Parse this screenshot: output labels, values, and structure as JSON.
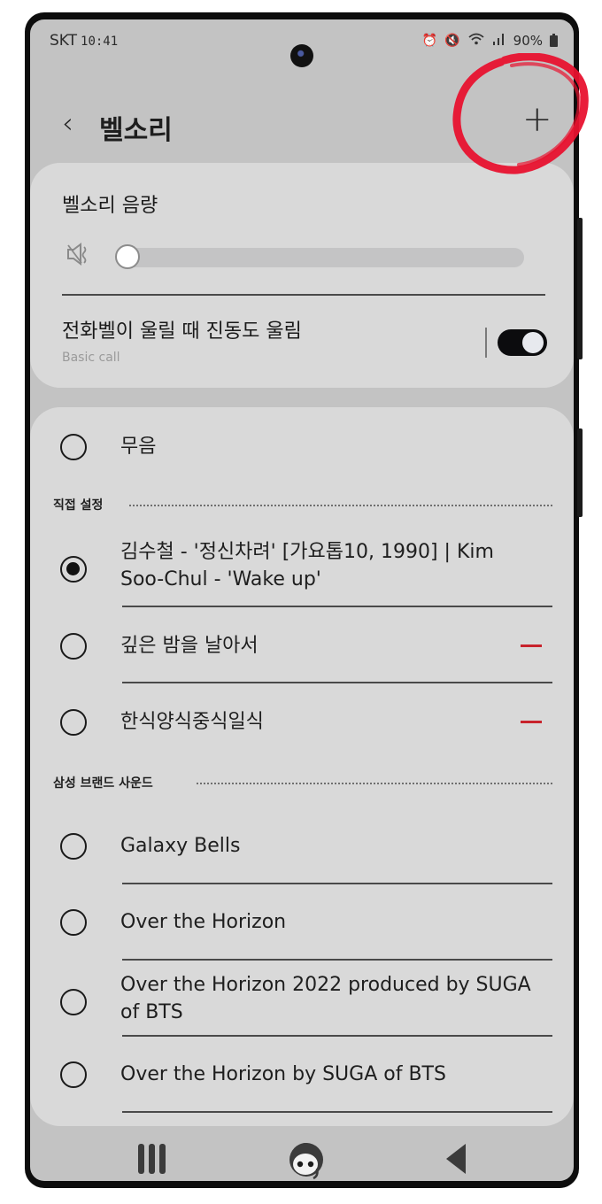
{
  "status_bar": {
    "carrier": "SKT",
    "time": "10:41",
    "icons": [
      "alarm-icon",
      "vibrate-mute-icon",
      "wifi-icon",
      "signal-icon"
    ],
    "battery": "90%"
  },
  "header": {
    "back_label": "‹",
    "title": "벨소리",
    "add_label": "+"
  },
  "volume": {
    "label": "벨소리 음량",
    "icon": "mute-icon",
    "level_fraction": 0.0
  },
  "vibrate": {
    "label": "전화벨이 울릴 때 진동도 울림",
    "sublabel": "Basic call",
    "enabled": true
  },
  "ringtones": {
    "silent": {
      "label": "무음",
      "selected": false
    },
    "sections": [
      {
        "title": "직접 설정",
        "items": [
          {
            "label": "김수철 - '정신차려' [가요톱10, 1990] | Kim Soo-Chul - 'Wake up'",
            "selected": true,
            "removable": false
          },
          {
            "label": "깊은 밤을 날아서",
            "selected": false,
            "removable": true
          },
          {
            "label": "한식양식중식일식",
            "selected": false,
            "removable": true
          }
        ]
      },
      {
        "title": "삼성 브랜드 사운드",
        "items": [
          {
            "label": "Galaxy Bells",
            "selected": false,
            "removable": false
          },
          {
            "label": "Over the Horizon",
            "selected": false,
            "removable": false
          },
          {
            "label": "Over the Horizon 2022 produced by SUGA of BTS",
            "selected": false,
            "removable": false
          },
          {
            "label": "Over the Horizon by SUGA of BTS",
            "selected": false,
            "removable": false
          }
        ]
      }
    ]
  },
  "nav_bar": {
    "recent_icon": "recent-apps-icon",
    "home_icon": "home-avatar-icon",
    "back_icon": "back-triangle-icon"
  },
  "colors": {
    "accent_remove": "#c8232c",
    "annotation": "#e8122f",
    "card_bg": "#d9d9d9",
    "screen_bg": "#c3c3c3"
  }
}
